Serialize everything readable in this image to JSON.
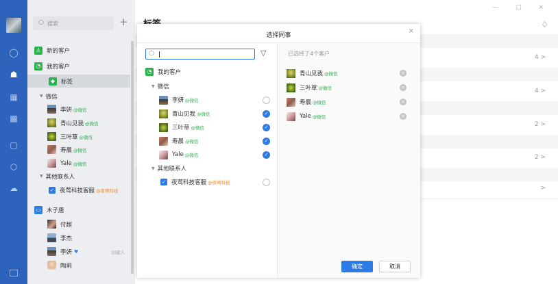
{
  "sidebar": {
    "search_placeholder": "搜索",
    "add_icon": "+",
    "items": [
      {
        "label": "新的客户",
        "icon": "new-customer-icon"
      },
      {
        "label": "我的客户",
        "icon": "wechat-icon"
      },
      {
        "label": "标签",
        "icon": "tag-icon",
        "selected": true
      },
      {
        "label": "微信"
      },
      {
        "label": "李妍",
        "sub": "@微信"
      },
      {
        "label": "青山见我",
        "sub": "@微信"
      },
      {
        "label": "三叶草",
        "sub": "@微信"
      },
      {
        "label": "寿晨",
        "sub": "@微信"
      },
      {
        "label": "Yale",
        "sub": "@微信"
      },
      {
        "label": "其他联系人"
      },
      {
        "label": "夜莺科技客服",
        "sub": "@夜莺科技"
      },
      {
        "label": "木子唐",
        "icon": "folder-icon"
      },
      {
        "label": "付超"
      },
      {
        "label": "李杰"
      },
      {
        "label": "李妍",
        "extra": "创建人"
      },
      {
        "label": "陶莉"
      }
    ]
  },
  "main": {
    "title": "标签",
    "window_controls": "— □ ×",
    "counts": [
      "4 >",
      "4 >",
      "2 >",
      "2 >",
      ">"
    ]
  },
  "modal": {
    "title": "选择同事",
    "close": "×",
    "root_label": "我的客户",
    "group1_label": "微信",
    "group2_label": "其他联系人",
    "contacts": [
      {
        "name": "李妍",
        "sub": "@微信",
        "checked": false
      },
      {
        "name": "青山见我",
        "sub": "@微信",
        "checked": true
      },
      {
        "name": "三叶草",
        "sub": "@微信",
        "checked": true
      },
      {
        "name": "寿晨",
        "sub": "@微信",
        "checked": true
      },
      {
        "name": "Yale",
        "sub": "@微信",
        "checked": true
      }
    ],
    "other_contact": {
      "name": "夜莺科技客服",
      "sub": "@夜莺科技",
      "checked": false
    },
    "selected_header": "已选择了4个客户",
    "selected": [
      {
        "name": "青山见我",
        "sub": "@微信"
      },
      {
        "name": "三叶草",
        "sub": "@微信"
      },
      {
        "name": "寿晨",
        "sub": "@微信"
      },
      {
        "name": "Yale",
        "sub": "@微信"
      }
    ],
    "ok_label": "确定",
    "cancel_label": "取消"
  },
  "colors": {
    "rail": "#2d62bd",
    "accent": "#2d7be5",
    "wechat_green": "#2faa4f",
    "org_orange": "#f08a2a"
  }
}
